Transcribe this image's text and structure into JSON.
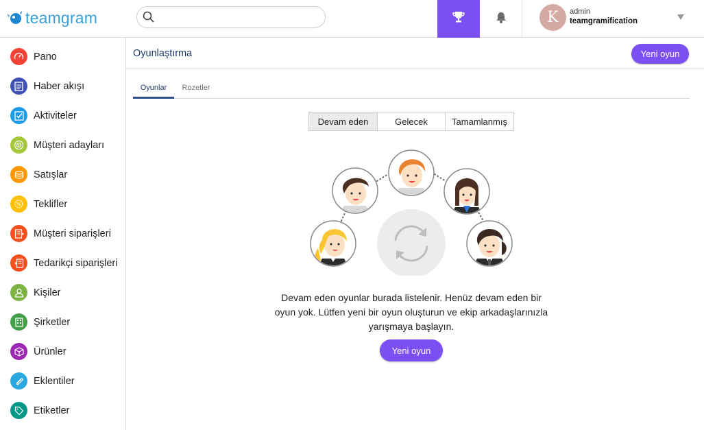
{
  "header": {
    "logo_text": "teamgram",
    "search_placeholder": "",
    "trophy_icon": "trophy-icon",
    "bell_icon": "bell-icon",
    "user": {
      "initial": "K",
      "role": "admin",
      "name": "teamgramification"
    }
  },
  "sidebar": {
    "items": [
      {
        "label": "Pano",
        "icon": "dashboard-gauge-icon",
        "color": "#f44336"
      },
      {
        "label": "Haber akışı",
        "icon": "newsfeed-icon",
        "color": "#3f51b5"
      },
      {
        "label": "Aktiviteler",
        "icon": "activities-check-icon",
        "color": "#1e9be8"
      },
      {
        "label": "Müşteri adayları",
        "icon": "leads-target-icon",
        "color": "#a4c639"
      },
      {
        "label": "Satışlar",
        "icon": "sales-coins-icon",
        "color": "#ff9800"
      },
      {
        "label": "Teklifler",
        "icon": "quotes-badge-icon",
        "color": "#ffc107"
      },
      {
        "label": "Müşteri siparişleri",
        "icon": "customer-orders-icon",
        "color": "#f4511e"
      },
      {
        "label": "Tedarikçi siparişleri",
        "icon": "supplier-orders-icon",
        "color": "#f4511e"
      },
      {
        "label": "Kişiler",
        "icon": "contacts-person-icon",
        "color": "#7cb342"
      },
      {
        "label": "Şirketler",
        "icon": "companies-building-icon",
        "color": "#43a047"
      },
      {
        "label": "Ürünler",
        "icon": "products-box-icon",
        "color": "#9c27b0"
      },
      {
        "label": "Eklentiler",
        "icon": "attachments-clip-icon",
        "color": "#29a8e0"
      },
      {
        "label": "Etiketler",
        "icon": "tags-icon",
        "color": "#009688"
      }
    ]
  },
  "page": {
    "title": "Oyunlaştırma",
    "new_game_label": "Yeni oyun",
    "tabs": [
      {
        "label": "Oyunlar",
        "active": true
      },
      {
        "label": "Rozetler",
        "active": false
      }
    ],
    "segments": [
      {
        "label": "Devam eden",
        "active": true
      },
      {
        "label": "Gelecek",
        "active": false
      },
      {
        "label": "Tamamlanmış",
        "active": false
      }
    ],
    "empty_message": "Devam eden oyunlar burada listelenir. Henüz devam eden bir oyun yok. Lütfen yeni bir oyun oluşturun ve ekip arkadaşlarınızla yarışmaya başlayın.",
    "empty_button_label": "Yeni oyun"
  },
  "colors": {
    "accent": "#7b4ff2",
    "title": "#1e3a68",
    "logo": "#3a9fd8"
  }
}
